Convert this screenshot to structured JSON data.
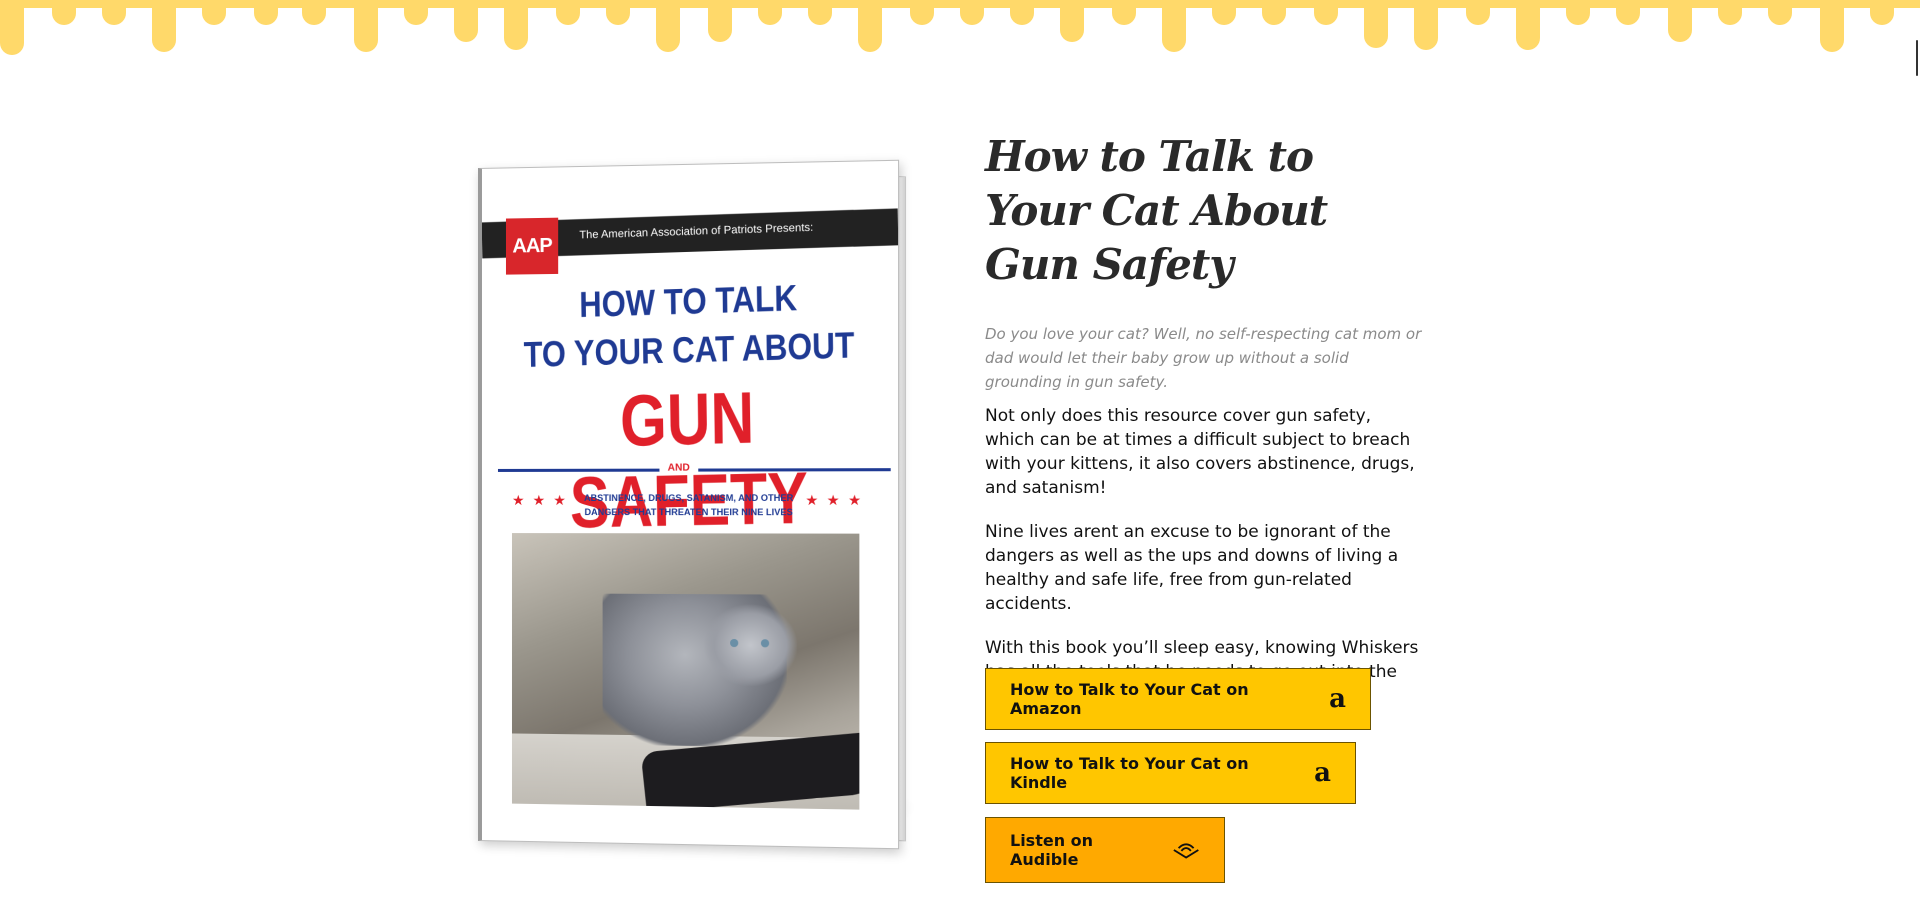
{
  "colors": {
    "drip": "#ffd96a",
    "button": "#ffc600",
    "audible_button": "#ffa900",
    "cover_blue": "#1f3a93",
    "cover_red": "#e0202a"
  },
  "book_cover": {
    "logo": "AAP",
    "publisher": "The American Association of Patriots Presents:",
    "title_line1": "HOW TO TALK",
    "title_line2": "TO YOUR CAT ABOUT",
    "title_line3": "GUN SAFETY",
    "and": "AND",
    "subtitle": "ABSTINENCE, DRUGS, SATANISM, AND OTHER DANGERS THAT THREATEN THEIR NINE LIVES",
    "stars": "★★★"
  },
  "main": {
    "title": "How to Talk to Your Cat About Gun Safety",
    "lead": "Do you love your cat? Well, no self-respecting cat mom or dad would let their baby grow up without a solid grounding in gun safety.",
    "paragraphs": [
      "Not only does this resource cover gun safety, which can be at times a difficult subject to breach with your kittens, it also covers abstinence, drugs, and satanism!",
      "Nine lives arent an excuse to be ignorant of the dangers as well as the ups and downs of living a healthy and safe life, free from gun-related accidents.",
      "With this book you’ll sleep easy, knowing Whiskers has all the tools that he needs to go out into the world in a safe and positive manner."
    ]
  },
  "buttons": {
    "amazon": {
      "label": "How to Talk to Your Cat on Amazon",
      "icon": "amazon-icon"
    },
    "kindle": {
      "label": "How to Talk to Your Cat on Kindle",
      "icon": "amazon-icon"
    },
    "audible": {
      "label": "Listen on Audible",
      "icon": "audible-icon"
    }
  }
}
